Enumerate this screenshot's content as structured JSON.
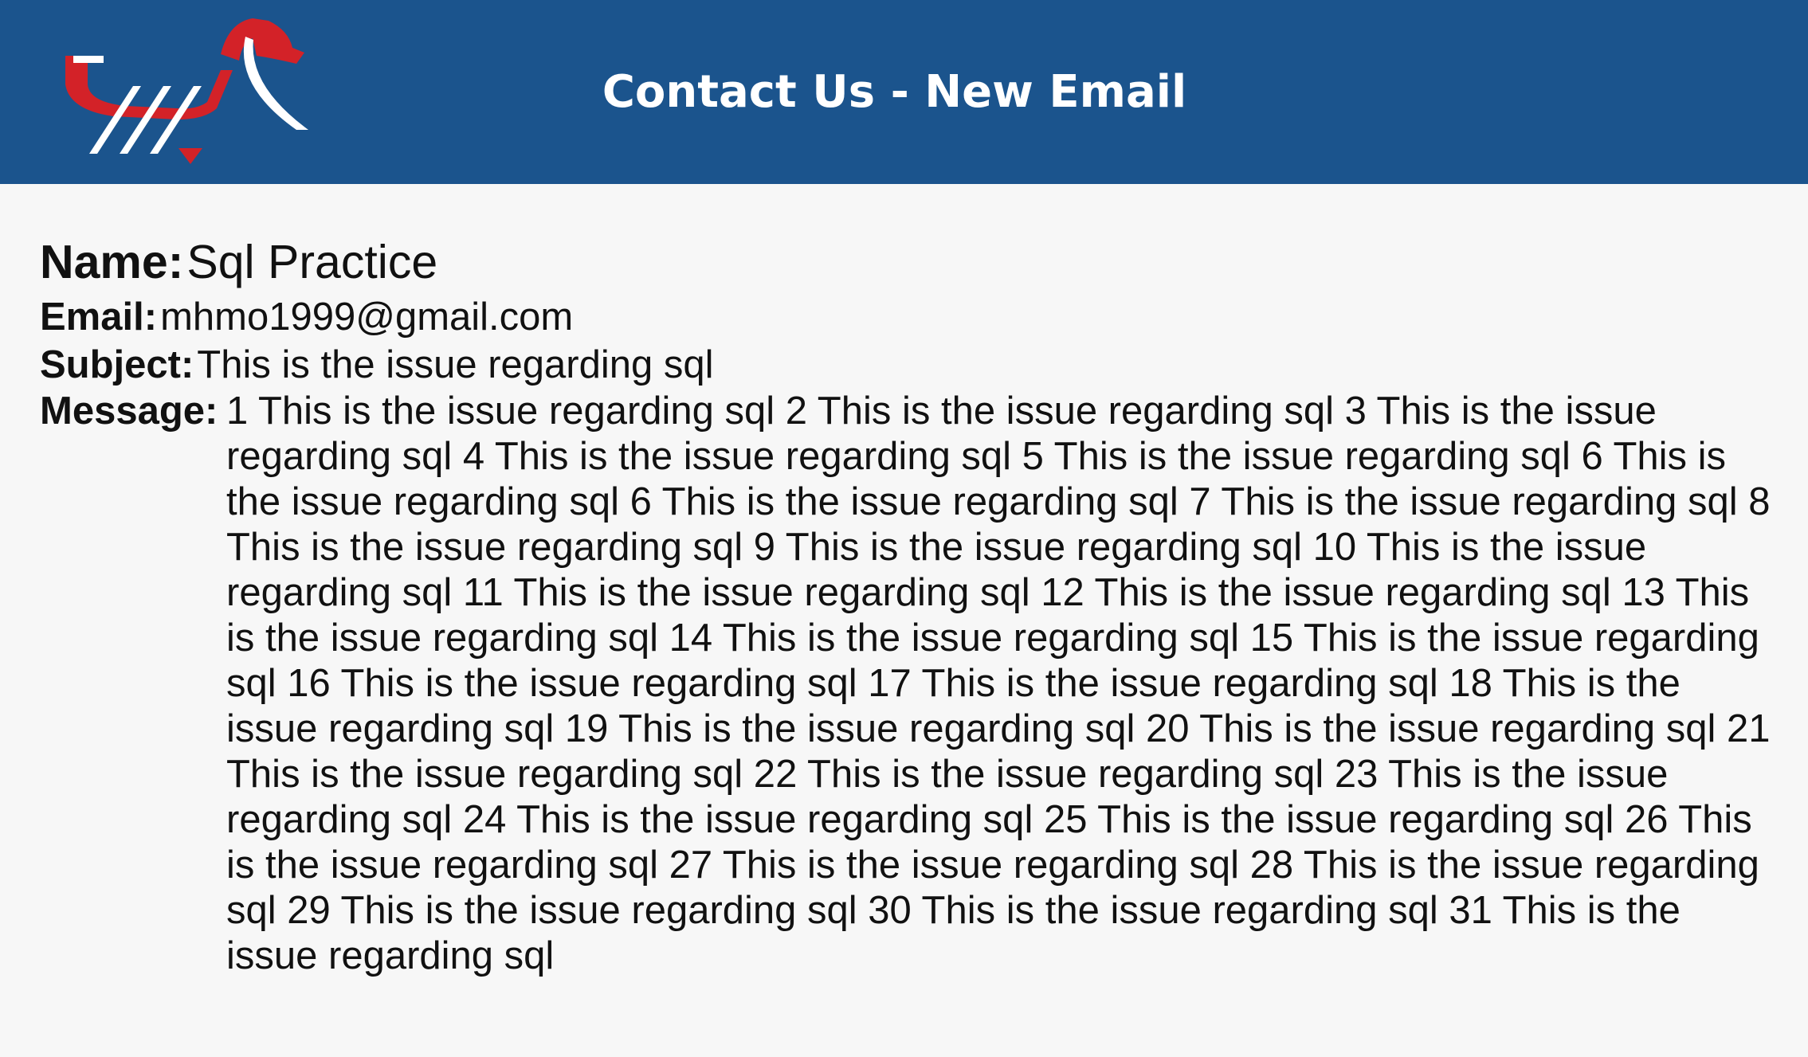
{
  "header": {
    "title": "Contact Us - New Email",
    "background_color": "#1b548d",
    "logo_icon": "brand-logo-icon"
  },
  "fields": {
    "name_label": "Name:",
    "name_value": "Sql Practice",
    "email_label": "Email:",
    "email_value": "mhmo1999@gmail.com",
    "subject_label": "Subject:",
    "subject_value": "This is the issue regarding sql",
    "message_label": "Message:",
    "message_value": "1 This is the issue regarding sql 2 This is the issue regarding sql 3 This is the issue regarding sql 4 This is the issue regarding sql 5 This is the issue regarding sql 6 This is the issue regarding sql 6 This is the issue regarding sql 7 This is the issue regarding sql 8 This is the issue regarding sql 9 This is the issue regarding sql 10 This is the issue regarding sql 11 This is the issue regarding sql 12 This is the issue regarding sql 13 This is the issue regarding sql 14 This is the issue regarding sql 15 This is the issue regarding sql 16 This is the issue regarding sql 17 This is the issue regarding sql 18 This is the issue regarding sql 19 This is the issue regarding sql 20 This is the issue regarding sql 21 This is the issue regarding sql 22 This is the issue regarding sql 23 This is the issue regarding sql 24 This is the issue regarding sql 25 This is the issue regarding sql 26 This is the issue regarding sql 27 This is the issue regarding sql 28 This is the issue regarding sql 29 This is the issue regarding sql 30 This is the issue regarding sql 31 This is the issue regarding sql"
  },
  "colors": {
    "accent_red": "#d32228",
    "page_background": "#f7f7f7",
    "text": "#111111"
  }
}
